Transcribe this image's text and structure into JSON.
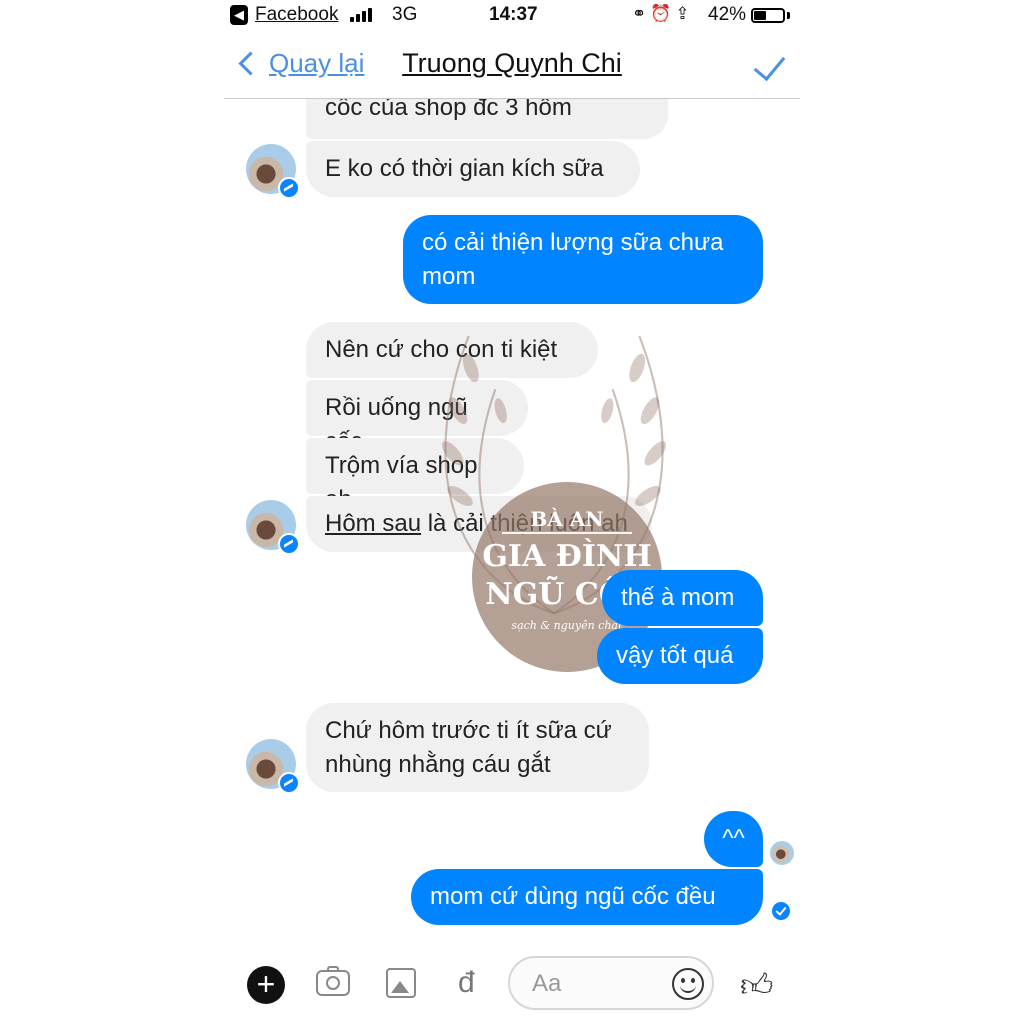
{
  "status_bar": {
    "back_app": "Facebook",
    "network": "3G",
    "time": "14:37",
    "battery": "42%",
    "battery_level": 0.42
  },
  "nav": {
    "back_label": "Quay lại",
    "title": "Truong Quynh Chi"
  },
  "messages": [
    {
      "side": "in",
      "text": "cốc của shop đc 3 hôm"
    },
    {
      "side": "in",
      "text": "E ko có thời gian kích sữa"
    },
    {
      "side": "out",
      "line1": "có cải thiện lượng sữa chưa",
      "line2": "mom"
    },
    {
      "side": "in",
      "text": "Nên cứ cho con ti kiệt"
    },
    {
      "side": "in",
      "text": "Rồi uống ngũ cốc"
    },
    {
      "side": "in",
      "text": "Trộm vía shop ah"
    },
    {
      "side": "in",
      "underlined": "Hôm sau",
      "rest": " là cải thiện luôn ah"
    },
    {
      "side": "out",
      "text": "thế à mom"
    },
    {
      "side": "out",
      "text": "vậy tốt quá"
    },
    {
      "side": "in",
      "line1": "Chứ hôm trước ti ít sữa cứ",
      "line2": "nhùng nhằng cáu gắt"
    },
    {
      "side": "out",
      "text": "^^"
    },
    {
      "side": "out",
      "text": "mom cứ dùng ngũ cốc đều"
    }
  ],
  "watermark": {
    "line1": "BÀ AN",
    "line2": "GIA ĐÌNH",
    "line3": "NGŨ CỐC",
    "tagline": "sạch & nguyên chất"
  },
  "composer": {
    "placeholder": "Aa",
    "currency_symbol": "đ"
  },
  "colors": {
    "accent": "#0084ff",
    "nav_blue": "#4a90e2",
    "incoming_bubble": "#f1f0f0"
  },
  "icons": [
    "camera-icon",
    "gallery-icon",
    "emoji-icon",
    "like-icon",
    "plus-icon",
    "checkmark-icon"
  ]
}
